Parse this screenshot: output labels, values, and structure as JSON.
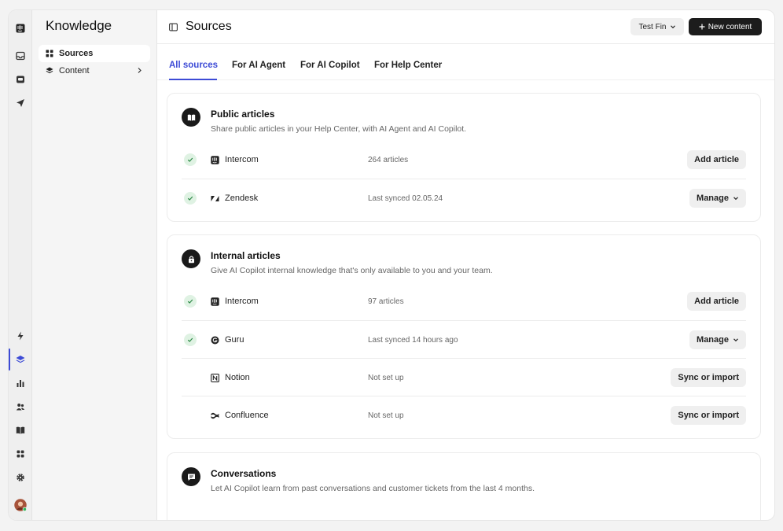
{
  "sidebar": {
    "title": "Knowledge",
    "items": [
      {
        "label": "Sources"
      },
      {
        "label": "Content"
      }
    ]
  },
  "header": {
    "title": "Sources",
    "test_button": "Test Fin",
    "new_button": "New content"
  },
  "tabs": [
    {
      "label": "All sources"
    },
    {
      "label": "For AI Agent"
    },
    {
      "label": "For AI Copilot"
    },
    {
      "label": "For Help Center"
    }
  ],
  "public_articles": {
    "title": "Public articles",
    "description": "Share public articles in your Help Center, with AI Agent and AI Copilot.",
    "rows": [
      {
        "name": "Intercom",
        "status": "264 articles",
        "action": "Add article"
      },
      {
        "name": "Zendesk",
        "status": "Last synced 02.05.24",
        "action": "Manage"
      }
    ]
  },
  "internal_articles": {
    "title": "Internal articles",
    "description": "Give AI Copilot internal knowledge that's only available to you and your team.",
    "rows": [
      {
        "name": "Intercom",
        "status": "97 articles",
        "action": "Add article"
      },
      {
        "name": "Guru",
        "status": "Last synced 14 hours ago",
        "action": "Manage"
      },
      {
        "name": "Notion",
        "status": "Not set up",
        "action": "Sync or import"
      },
      {
        "name": "Confluence",
        "status": "Not set up",
        "action": "Sync or import"
      }
    ]
  },
  "conversations": {
    "title": "Conversations",
    "description": "Let AI Copilot learn from past conversations and customer tickets from the last 4 months."
  },
  "colors": {
    "accent": "#3d4bd6",
    "check_bg": "#dff2e3",
    "check": "#2f8a48",
    "dark": "#1c1c1c"
  }
}
